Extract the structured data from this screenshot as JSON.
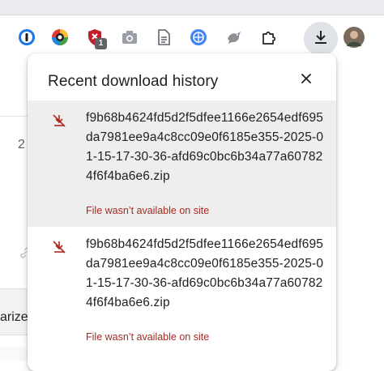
{
  "toolbar": {
    "extensions": [
      {
        "icon": "password-manager-icon"
      },
      {
        "icon": "color-wheel-icon"
      },
      {
        "icon": "shield-icon",
        "badge": "1"
      },
      {
        "icon": "camera-icon"
      },
      {
        "icon": "document-icon"
      },
      {
        "icon": "globe-badge-icon"
      },
      {
        "icon": "bird-icon"
      },
      {
        "icon": "puzzle-icon"
      },
      {
        "icon": "download-icon"
      },
      {
        "icon": "avatar"
      }
    ]
  },
  "background": {
    "number_fragment": "2",
    "button_fragment": "arize"
  },
  "popup": {
    "title": "Recent download history",
    "close_icon": "close-icon",
    "items": [
      {
        "filename": "f9b68b4624fd5d2f5dfee1166e2654edf695da7981ee9a4c8cc09e0f6185e355-2025-01-15-17-30-36-afd69c0bc6b34a77a607824f6f4ba6e6.zip",
        "status": "File wasn’t available on site",
        "icon": "download-off-icon"
      },
      {
        "filename": "f9b68b4624fd5d2f5dfee1166e2654edf695da7981ee9a4c8cc09e0f6185e355-2025-01-15-17-30-36-afd69c0bc6b34a77a607824f6f4ba6e6.zip",
        "status": "File wasn’t available on site",
        "icon": "download-off-icon"
      }
    ]
  },
  "colors": {
    "error_text": "#a52a22",
    "error_icon": "#b3261e",
    "hover_bg": "#eeeeee"
  }
}
